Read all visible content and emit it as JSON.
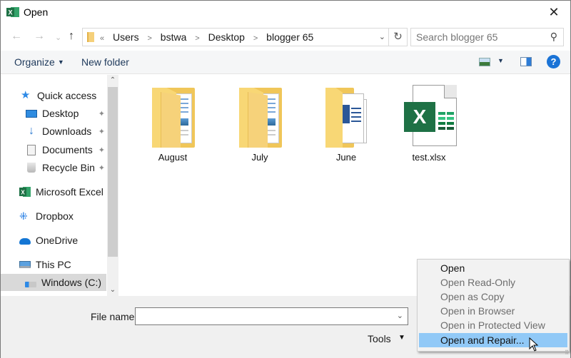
{
  "window": {
    "title": "Open",
    "close_label": "✕"
  },
  "nav": {
    "back": "←",
    "forward": "→",
    "recent": "⌄",
    "up": "↑",
    "breadcrumb_overflow": "«",
    "breadcrumb": [
      "Users",
      "bstwa",
      "Desktop",
      "blogger 65"
    ],
    "dropdown": "⌄",
    "refresh": "↻",
    "search_placeholder": "Search blogger 65",
    "search_icon": "⚲"
  },
  "toolbar": {
    "organize_label": "Organize",
    "organize_caret": "▼",
    "new_folder_label": "New folder",
    "view_caret": "▼",
    "help_label": "?"
  },
  "sidebar": {
    "items": [
      {
        "label": "Quick access",
        "icon": "star-icon"
      },
      {
        "label": "Desktop",
        "icon": "desktop-icon",
        "pinned": true
      },
      {
        "label": "Downloads",
        "icon": "download-icon",
        "pinned": true
      },
      {
        "label": "Documents",
        "icon": "documents-icon",
        "pinned": true
      },
      {
        "label": "Recycle Bin",
        "icon": "recycle-bin-icon",
        "pinned": true
      },
      {
        "label": "Microsoft Excel",
        "icon": "excel-icon"
      },
      {
        "label": "Dropbox",
        "icon": "dropbox-icon"
      },
      {
        "label": "OneDrive",
        "icon": "onedrive-icon"
      },
      {
        "label": "This PC",
        "icon": "computer-icon"
      },
      {
        "label": "Windows (C:)",
        "icon": "drive-icon",
        "selected": true
      }
    ],
    "pin_glyph": "📌",
    "scroll_up": "⌃",
    "scroll_down": "⌄"
  },
  "files": [
    {
      "name": "August",
      "type": "folder"
    },
    {
      "name": "July",
      "type": "folder"
    },
    {
      "name": "June",
      "type": "folder"
    },
    {
      "name": "test.xlsx",
      "type": "excel-file"
    }
  ],
  "excel_badge": "X",
  "footer": {
    "file_name_label": "File name:",
    "file_name_value": "",
    "file_name_dropdown": "⌄",
    "tools_label": "Tools",
    "tools_caret": "▼"
  },
  "menu": {
    "items": [
      {
        "label": "Open",
        "enabled": true
      },
      {
        "label": "Open Read-Only",
        "enabled": false
      },
      {
        "label": "Open as Copy",
        "enabled": false
      },
      {
        "label": "Open in Browser",
        "enabled": false
      },
      {
        "label": "Open in Protected View",
        "enabled": false
      },
      {
        "label": "Open and Repair...",
        "enabled": true,
        "highlighted": true
      }
    ],
    "grip": "⠿"
  },
  "colors": {
    "excel_green": "#1e7145",
    "menu_highlight": "#91c9f7",
    "folder_yellow": "#f8d775",
    "help_blue": "#1a73d6"
  }
}
